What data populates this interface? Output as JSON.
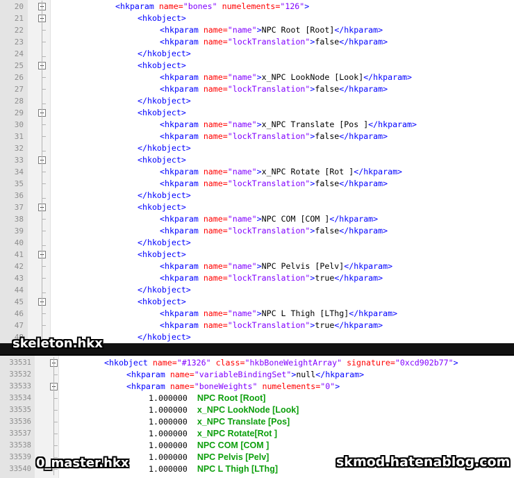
{
  "top_pane": {
    "label": "skeleton.hkx",
    "lines": [
      {
        "n": "20",
        "indent": 0,
        "tokens": [
          [
            "tag",
            "<hkparam "
          ],
          [
            "attr",
            "name="
          ],
          [
            "val",
            "\"bones\""
          ],
          [
            "txt",
            " "
          ],
          [
            "attr",
            "numelements="
          ],
          [
            "val",
            "\"126\""
          ],
          [
            "tag",
            ">"
          ]
        ]
      },
      {
        "n": "21",
        "indent": 1,
        "tokens": [
          [
            "tag",
            "<hkobject>"
          ]
        ]
      },
      {
        "n": "22",
        "indent": 2,
        "tokens": [
          [
            "tag",
            "<hkparam "
          ],
          [
            "attr",
            "name="
          ],
          [
            "val",
            "\"name\""
          ],
          [
            "tag",
            ">"
          ],
          [
            "txt",
            "NPC Root [Root]"
          ],
          [
            "tag",
            "</hkparam>"
          ]
        ]
      },
      {
        "n": "23",
        "indent": 2,
        "tokens": [
          [
            "tag",
            "<hkparam "
          ],
          [
            "attr",
            "name="
          ],
          [
            "val",
            "\"lockTranslation\""
          ],
          [
            "tag",
            ">"
          ],
          [
            "txt",
            "false"
          ],
          [
            "tag",
            "</hkparam>"
          ]
        ]
      },
      {
        "n": "24",
        "indent": 1,
        "tokens": [
          [
            "tag",
            "</hkobject>"
          ]
        ]
      },
      {
        "n": "25",
        "indent": 1,
        "tokens": [
          [
            "tag",
            "<hkobject>"
          ]
        ]
      },
      {
        "n": "26",
        "indent": 2,
        "tokens": [
          [
            "tag",
            "<hkparam "
          ],
          [
            "attr",
            "name="
          ],
          [
            "val",
            "\"name\""
          ],
          [
            "tag",
            ">"
          ],
          [
            "txt",
            "x_NPC LookNode [Look]"
          ],
          [
            "tag",
            "</hkparam>"
          ]
        ]
      },
      {
        "n": "27",
        "indent": 2,
        "tokens": [
          [
            "tag",
            "<hkparam "
          ],
          [
            "attr",
            "name="
          ],
          [
            "val",
            "\"lockTranslation\""
          ],
          [
            "tag",
            ">"
          ],
          [
            "txt",
            "false"
          ],
          [
            "tag",
            "</hkparam>"
          ]
        ]
      },
      {
        "n": "28",
        "indent": 1,
        "tokens": [
          [
            "tag",
            "</hkobject>"
          ]
        ]
      },
      {
        "n": "29",
        "indent": 1,
        "tokens": [
          [
            "tag",
            "<hkobject>"
          ]
        ]
      },
      {
        "n": "30",
        "indent": 2,
        "tokens": [
          [
            "tag",
            "<hkparam "
          ],
          [
            "attr",
            "name="
          ],
          [
            "val",
            "\"name\""
          ],
          [
            "tag",
            ">"
          ],
          [
            "txt",
            "x_NPC Translate [Pos ]"
          ],
          [
            "tag",
            "</hkparam>"
          ]
        ]
      },
      {
        "n": "31",
        "indent": 2,
        "tokens": [
          [
            "tag",
            "<hkparam "
          ],
          [
            "attr",
            "name="
          ],
          [
            "val",
            "\"lockTranslation\""
          ],
          [
            "tag",
            ">"
          ],
          [
            "txt",
            "false"
          ],
          [
            "tag",
            "</hkparam>"
          ]
        ]
      },
      {
        "n": "32",
        "indent": 1,
        "tokens": [
          [
            "tag",
            "</hkobject>"
          ]
        ]
      },
      {
        "n": "33",
        "indent": 1,
        "tokens": [
          [
            "tag",
            "<hkobject>"
          ]
        ]
      },
      {
        "n": "34",
        "indent": 2,
        "tokens": [
          [
            "tag",
            "<hkparam "
          ],
          [
            "attr",
            "name="
          ],
          [
            "val",
            "\"name\""
          ],
          [
            "tag",
            ">"
          ],
          [
            "txt",
            "x_NPC Rotate [Rot ]"
          ],
          [
            "tag",
            "</hkparam>"
          ]
        ]
      },
      {
        "n": "35",
        "indent": 2,
        "tokens": [
          [
            "tag",
            "<hkparam "
          ],
          [
            "attr",
            "name="
          ],
          [
            "val",
            "\"lockTranslation\""
          ],
          [
            "tag",
            ">"
          ],
          [
            "txt",
            "false"
          ],
          [
            "tag",
            "</hkparam>"
          ]
        ]
      },
      {
        "n": "36",
        "indent": 1,
        "tokens": [
          [
            "tag",
            "</hkobject>"
          ]
        ]
      },
      {
        "n": "37",
        "indent": 1,
        "tokens": [
          [
            "tag",
            "<hkobject>"
          ]
        ]
      },
      {
        "n": "38",
        "indent": 2,
        "tokens": [
          [
            "tag",
            "<hkparam "
          ],
          [
            "attr",
            "name="
          ],
          [
            "val",
            "\"name\""
          ],
          [
            "tag",
            ">"
          ],
          [
            "txt",
            "NPC COM [COM ]"
          ],
          [
            "tag",
            "</hkparam>"
          ]
        ]
      },
      {
        "n": "39",
        "indent": 2,
        "tokens": [
          [
            "tag",
            "<hkparam "
          ],
          [
            "attr",
            "name="
          ],
          [
            "val",
            "\"lockTranslation\""
          ],
          [
            "tag",
            ">"
          ],
          [
            "txt",
            "false"
          ],
          [
            "tag",
            "</hkparam>"
          ]
        ]
      },
      {
        "n": "40",
        "indent": 1,
        "tokens": [
          [
            "tag",
            "</hkobject>"
          ]
        ]
      },
      {
        "n": "41",
        "indent": 1,
        "tokens": [
          [
            "tag",
            "<hkobject>"
          ]
        ]
      },
      {
        "n": "42",
        "indent": 2,
        "tokens": [
          [
            "tag",
            "<hkparam "
          ],
          [
            "attr",
            "name="
          ],
          [
            "val",
            "\"name\""
          ],
          [
            "tag",
            ">"
          ],
          [
            "txt",
            "NPC Pelvis [Pelv]"
          ],
          [
            "tag",
            "</hkparam>"
          ]
        ]
      },
      {
        "n": "43",
        "indent": 2,
        "tokens": [
          [
            "tag",
            "<hkparam "
          ],
          [
            "attr",
            "name="
          ],
          [
            "val",
            "\"lockTranslation\""
          ],
          [
            "tag",
            ">"
          ],
          [
            "txt",
            "true"
          ],
          [
            "tag",
            "</hkparam>"
          ]
        ]
      },
      {
        "n": "44",
        "indent": 1,
        "tokens": [
          [
            "tag",
            "</hkobject>"
          ]
        ]
      },
      {
        "n": "45",
        "indent": 1,
        "tokens": [
          [
            "tag",
            "<hkobject>"
          ]
        ]
      },
      {
        "n": "46",
        "indent": 2,
        "tokens": [
          [
            "tag",
            "<hkparam "
          ],
          [
            "attr",
            "name="
          ],
          [
            "val",
            "\"name\""
          ],
          [
            "tag",
            ">"
          ],
          [
            "txt",
            "NPC L Thigh [LThg]"
          ],
          [
            "tag",
            "</hkparam>"
          ]
        ]
      },
      {
        "n": "47",
        "indent": 2,
        "tokens": [
          [
            "tag",
            "<hkparam "
          ],
          [
            "attr",
            "name="
          ],
          [
            "val",
            "\"lockTranslation\""
          ],
          [
            "tag",
            ">"
          ],
          [
            "txt",
            "true"
          ],
          [
            "tag",
            "</hkparam>"
          ]
        ]
      },
      {
        "n": "48",
        "indent": 1,
        "tokens": [
          [
            "tag",
            "</hkobject>"
          ]
        ]
      }
    ]
  },
  "bottom_pane": {
    "label": "0_master.hkx",
    "watermark": "skmod.hatenablog.com",
    "lines": [
      {
        "n": "33531",
        "indent": 0,
        "tokens": [
          [
            "tag",
            "<hkobject "
          ],
          [
            "attr",
            "name="
          ],
          [
            "val",
            "\"#1326\""
          ],
          [
            "txt",
            " "
          ],
          [
            "attr",
            "class="
          ],
          [
            "val",
            "\"hkbBoneWeightArray\""
          ],
          [
            "txt",
            " "
          ],
          [
            "attr",
            "signature="
          ],
          [
            "val",
            "\"0xcd902b77\""
          ],
          [
            "tag",
            ">"
          ]
        ]
      },
      {
        "n": "33532",
        "indent": 1,
        "tokens": [
          [
            "tag",
            "<hkparam "
          ],
          [
            "attr",
            "name="
          ],
          [
            "val",
            "\"variableBindingSet\""
          ],
          [
            "tag",
            ">"
          ],
          [
            "txt",
            "null"
          ],
          [
            "tag",
            "</hkparam>"
          ]
        ]
      },
      {
        "n": "33533",
        "indent": 1,
        "tokens": [
          [
            "tag",
            "<hkparam "
          ],
          [
            "attr",
            "name="
          ],
          [
            "val",
            "\"boneWeights\""
          ],
          [
            "txt",
            " "
          ],
          [
            "attr",
            "numelements="
          ],
          [
            "val",
            "\"0\""
          ],
          [
            "tag",
            ">"
          ]
        ]
      },
      {
        "n": "33534",
        "indent": 2,
        "tokens": [
          [
            "num",
            "1.000000  "
          ],
          [
            "g",
            "NPC Root [Root]"
          ]
        ]
      },
      {
        "n": "33535",
        "indent": 2,
        "tokens": [
          [
            "num",
            "1.000000  "
          ],
          [
            "g",
            "x_NPC LookNode [Look]"
          ]
        ]
      },
      {
        "n": "33536",
        "indent": 2,
        "tokens": [
          [
            "num",
            "1.000000  "
          ],
          [
            "g",
            "x_NPC Translate [Pos]"
          ]
        ]
      },
      {
        "n": "33537",
        "indent": 2,
        "tokens": [
          [
            "num",
            "1.000000  "
          ],
          [
            "g",
            "x_NPC Rotate[Rot ]"
          ]
        ]
      },
      {
        "n": "33538",
        "indent": 2,
        "tokens": [
          [
            "num",
            "1.000000  "
          ],
          [
            "g",
            "NPC COM [COM ]"
          ]
        ]
      },
      {
        "n": "33539",
        "indent": 2,
        "tokens": [
          [
            "num",
            "1.000000  "
          ],
          [
            "g",
            "NPC Pelvis [Pelv]"
          ]
        ]
      },
      {
        "n": "33540",
        "indent": 2,
        "tokens": [
          [
            "num",
            "1.000000  "
          ],
          [
            "g",
            "NPC L Thigh [LThg]"
          ]
        ]
      }
    ]
  }
}
